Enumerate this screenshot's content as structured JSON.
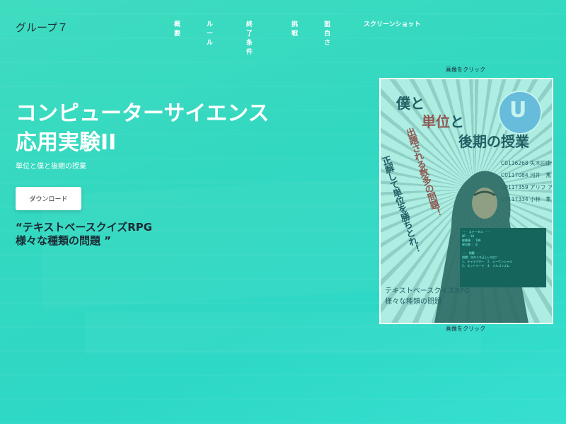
{
  "brand": "グループ７",
  "nav": [
    "概要",
    "ルール",
    "終了条件",
    "挑戦",
    "面白さ",
    "スクリーンショット"
  ],
  "hero": {
    "title": "コンピューターサイエンス応用実験II",
    "subtitle": "単位と僕と後期の授業",
    "download_label": "ダウンロード",
    "quote": "“テキストベースクイズRPG\n様々な種類の問題 ”"
  },
  "image_caption_top": "画像をクリック",
  "image_caption_bottom": "画像をクリック",
  "poster": {
    "title_line1": "僕と",
    "title_line2_red": "単位",
    "title_line2_rest": "と",
    "title_line3": "後期の授業",
    "logo_letter": "U",
    "vertical_red": "出題される数多の問題！",
    "vertical_dark": "正解して単位を勝ちとれ！",
    "names": "C0116268 矢木田康佑\nC0117084 河井　篤\nC0117359 アリフ アイマン\nC0117334 小林　隼人",
    "bottom_text": "テキストベースクイズRPG\n様々な種類の問題",
    "terminal_text": "--- ステータス ---\nHP : 10\n経験値 : 100\n単位数 : 0\n\n--- 問題 ---\n問題：次のうち正しいのは？\n1. キャラクター  2. シーケンシャル\n3. ネットワーク  4. アルゴリズム"
  },
  "colors": {
    "bg_start": "#3fdcc0",
    "bg_end": "#36dfd0",
    "brand_text": "#1f2d3d",
    "poster_red": "#b52828"
  }
}
